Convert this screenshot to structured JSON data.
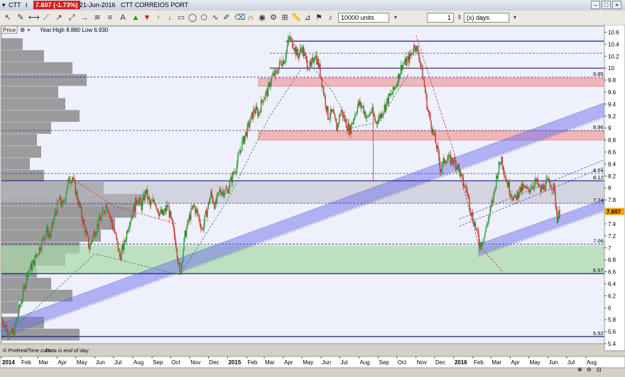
{
  "window": {
    "symbol": "CTT",
    "price_badge": "7.607 (-1.73%)",
    "date": "21-Jun-2016",
    "name": "CTT CORREIOS PORT"
  },
  "toolbar": {
    "quantity": "10000 units",
    "period_count": "1",
    "period_unit": "(x) days",
    "icons": [
      "cursor-icon",
      "pencil-icon",
      "horizontal-line-icon",
      "trend-line-icon",
      "ray-icon",
      "extend-line-icon",
      "horizontal-ray-icon",
      "parallel-channel-icon",
      "fibonacci-icon",
      "text-icon",
      "buy-arrow-icon",
      "sell-arrow-icon",
      "up-arrow-icon",
      "down-arrow-icon",
      "rectangle-icon",
      "ellipse-icon",
      "polygon-icon",
      "curve-icon",
      "brush-icon",
      "eraser-icon",
      "magnet-icon",
      "eye-icon",
      "settings-icon",
      "grid-icon",
      "ruler-icon",
      "measure-icon",
      "flag-icon",
      "bell-icon",
      "lock-icon",
      "trash-icon"
    ]
  },
  "info": {
    "price_label": "Price",
    "range_text": "Year:High 8.880 Low 6.930",
    "footer_brand": "© ProRealTime.com",
    "footer_note": "Data is end of day"
  },
  "colors": {
    "plot_bg": "#ffffff",
    "plot_bg_tint": "#eef0fb",
    "up_candle": "#2e9a3a",
    "down_candle": "#c0392b",
    "channel": "#6b6bef",
    "resistance": "#1a1a8c",
    "red_zone": "#f2a0a0",
    "green_zone": "#a8d8a8",
    "gray_zone": "#bdbdc9",
    "volume_profile": "#8c8c8c",
    "last_price": "#ffa000"
  },
  "chart_data": {
    "type": "candlestick",
    "title": "CTT CORREIOS PORT",
    "x_range": [
      "2014-01-01",
      "2016-08-31"
    ],
    "ylim": [
      5.4,
      10.7
    ],
    "y_ticks": [
      "5.4",
      "5.6",
      "5.8",
      "6",
      "6.2",
      "6.4",
      "6.6",
      "6.8",
      "7",
      "7.2",
      "7.4",
      "7.6",
      "7.8",
      "8",
      "8.2",
      "8.4",
      "8.6",
      "8.8",
      "9",
      "9.2",
      "9.4",
      "9.6",
      "9.8",
      "10",
      "10.2",
      "10.4",
      "10.6"
    ],
    "x_ticks": [
      {
        "label": "2014",
        "date": "2014-01-01"
      },
      {
        "label": "Feb",
        "date": "2014-02-01"
      },
      {
        "label": "Mar",
        "date": "2014-03-01"
      },
      {
        "label": "Apr",
        "date": "2014-04-01"
      },
      {
        "label": "May",
        "date": "2014-05-01"
      },
      {
        "label": "Jun",
        "date": "2014-06-01"
      },
      {
        "label": "Jul",
        "date": "2014-07-01"
      },
      {
        "label": "Aug",
        "date": "2014-08-01"
      },
      {
        "label": "Sep",
        "date": "2014-09-01"
      },
      {
        "label": "Oct",
        "date": "2014-10-01"
      },
      {
        "label": "Nov",
        "date": "2014-11-01"
      },
      {
        "label": "Dec",
        "date": "2014-12-01"
      },
      {
        "label": "2015",
        "date": "2015-01-01"
      },
      {
        "label": "Feb",
        "date": "2015-02-01"
      },
      {
        "label": "Mar",
        "date": "2015-03-01"
      },
      {
        "label": "Apr",
        "date": "2015-04-01"
      },
      {
        "label": "May",
        "date": "2015-05-01"
      },
      {
        "label": "Jun",
        "date": "2015-06-01"
      },
      {
        "label": "Jul",
        "date": "2015-07-01"
      },
      {
        "label": "Aug",
        "date": "2015-08-01"
      },
      {
        "label": "Sep",
        "date": "2015-09-01"
      },
      {
        "label": "Oct",
        "date": "2015-10-01"
      },
      {
        "label": "Nov",
        "date": "2015-11-01"
      },
      {
        "label": "Dec",
        "date": "2015-12-01"
      },
      {
        "label": "2016",
        "date": "2016-01-01"
      },
      {
        "label": "Feb",
        "date": "2016-02-01"
      },
      {
        "label": "Mar",
        "date": "2016-03-01"
      },
      {
        "label": "Apr",
        "date": "2016-04-01"
      },
      {
        "label": "May",
        "date": "2016-05-01"
      },
      {
        "label": "Jun",
        "date": "2016-06-01"
      },
      {
        "label": "Jul",
        "date": "2016-07-01"
      },
      {
        "label": "Aug",
        "date": "2016-08-01"
      }
    ],
    "price_path": [
      [
        "2014-01-02",
        5.8
      ],
      [
        "2014-01-10",
        5.62
      ],
      [
        "2014-01-20",
        5.55
      ],
      [
        "2014-01-28",
        5.9
      ],
      [
        "2014-02-05",
        6.25
      ],
      [
        "2014-02-12",
        6.6
      ],
      [
        "2014-02-20",
        6.7
      ],
      [
        "2014-02-27",
        6.9
      ],
      [
        "2014-03-06",
        7.05
      ],
      [
        "2014-03-14",
        7.3
      ],
      [
        "2014-03-21",
        7.2
      ],
      [
        "2014-03-28",
        7.55
      ],
      [
        "2014-04-04",
        7.8
      ],
      [
        "2014-04-11",
        7.7
      ],
      [
        "2014-04-17",
        8.05
      ],
      [
        "2014-04-25",
        8.2
      ],
      [
        "2014-05-02",
        7.9
      ],
      [
        "2014-05-09",
        7.6
      ],
      [
        "2014-05-16",
        7.3
      ],
      [
        "2014-05-23",
        7.0
      ],
      [
        "2014-05-30",
        7.25
      ],
      [
        "2014-06-06",
        7.4
      ],
      [
        "2014-06-13",
        7.55
      ],
      [
        "2014-06-20",
        7.75
      ],
      [
        "2014-06-27",
        7.45
      ],
      [
        "2014-07-04",
        7.2
      ],
      [
        "2014-07-11",
        6.85
      ],
      [
        "2014-07-18",
        7.05
      ],
      [
        "2014-07-25",
        7.4
      ],
      [
        "2014-08-01",
        7.6
      ],
      [
        "2014-08-08",
        7.85
      ],
      [
        "2014-08-15",
        7.7
      ],
      [
        "2014-08-22",
        7.95
      ],
      [
        "2014-08-29",
        7.7
      ],
      [
        "2014-09-05",
        7.8
      ],
      [
        "2014-09-12",
        7.6
      ],
      [
        "2014-09-19",
        7.55
      ],
      [
        "2014-09-26",
        7.7
      ],
      [
        "2014-10-03",
        7.4
      ],
      [
        "2014-10-10",
        7.05
      ],
      [
        "2014-10-16",
        6.55
      ],
      [
        "2014-10-24",
        7.2
      ],
      [
        "2014-10-31",
        7.5
      ],
      [
        "2014-11-07",
        7.7
      ],
      [
        "2014-11-14",
        7.55
      ],
      [
        "2014-11-21",
        7.3
      ],
      [
        "2014-11-28",
        7.6
      ],
      [
        "2014-12-05",
        7.9
      ],
      [
        "2014-12-12",
        7.7
      ],
      [
        "2014-12-19",
        7.95
      ],
      [
        "2014-12-31",
        7.95
      ],
      [
        "2015-01-09",
        8.2
      ],
      [
        "2015-01-16",
        8.4
      ],
      [
        "2015-01-23",
        8.7
      ],
      [
        "2015-01-30",
        8.9
      ],
      [
        "2015-02-06",
        9.1
      ],
      [
        "2015-02-13",
        9.3
      ],
      [
        "2015-02-20",
        9.25
      ],
      [
        "2015-02-27",
        9.5
      ],
      [
        "2015-03-06",
        9.6
      ],
      [
        "2015-03-13",
        9.85
      ],
      [
        "2015-03-20",
        9.9
      ],
      [
        "2015-03-27",
        10.1
      ],
      [
        "2015-04-03",
        10.15
      ],
      [
        "2015-04-10",
        10.5
      ],
      [
        "2015-04-17",
        10.4
      ],
      [
        "2015-04-24",
        10.2
      ],
      [
        "2015-05-01",
        10.35
      ],
      [
        "2015-05-08",
        10.1
      ],
      [
        "2015-05-15",
        10.0
      ],
      [
        "2015-05-22",
        10.25
      ],
      [
        "2015-05-29",
        10.0
      ],
      [
        "2015-06-05",
        9.6
      ],
      [
        "2015-06-12",
        9.2
      ],
      [
        "2015-06-19",
        9.25
      ],
      [
        "2015-06-26",
        9.0
      ],
      [
        "2015-07-03",
        9.3
      ],
      [
        "2015-07-10",
        9.1
      ],
      [
        "2015-07-17",
        8.95
      ],
      [
        "2015-07-24",
        9.2
      ],
      [
        "2015-07-31",
        9.4
      ],
      [
        "2015-08-07",
        9.35
      ],
      [
        "2015-08-14",
        9.15
      ],
      [
        "2015-08-21",
        9.3
      ],
      [
        "2015-08-28",
        9.1
      ],
      [
        "2015-09-04",
        9.2
      ],
      [
        "2015-09-11",
        9.35
      ],
      [
        "2015-09-18",
        9.5
      ],
      [
        "2015-09-25",
        9.6
      ],
      [
        "2015-10-02",
        9.8
      ],
      [
        "2015-10-09",
        10.05
      ],
      [
        "2015-10-16",
        10.1
      ],
      [
        "2015-10-23",
        10.2
      ],
      [
        "2015-10-30",
        10.4
      ],
      [
        "2015-11-06",
        10.2
      ],
      [
        "2015-11-13",
        9.8
      ],
      [
        "2015-11-20",
        9.3
      ],
      [
        "2015-11-27",
        9.0
      ],
      [
        "2015-12-04",
        8.7
      ],
      [
        "2015-12-11",
        8.3
      ],
      [
        "2015-12-18",
        8.5
      ],
      [
        "2015-12-31",
        8.45
      ],
      [
        "2016-01-08",
        8.35
      ],
      [
        "2016-01-15",
        8.1
      ],
      [
        "2016-01-22",
        7.95
      ],
      [
        "2016-01-29",
        7.6
      ],
      [
        "2016-02-05",
        7.35
      ],
      [
        "2016-02-12",
        7.05
      ],
      [
        "2016-02-19",
        7.2
      ],
      [
        "2016-02-26",
        7.5
      ],
      [
        "2016-03-04",
        7.8
      ],
      [
        "2016-03-11",
        8.25
      ],
      [
        "2016-03-18",
        8.5
      ],
      [
        "2016-03-25",
        8.15
      ],
      [
        "2016-04-01",
        7.95
      ],
      [
        "2016-04-08",
        7.8
      ],
      [
        "2016-04-15",
        7.95
      ],
      [
        "2016-04-22",
        8.0
      ],
      [
        "2016-04-29",
        7.95
      ],
      [
        "2016-05-06",
        8.05
      ],
      [
        "2016-05-13",
        8.1
      ],
      [
        "2016-05-20",
        7.95
      ],
      [
        "2016-05-27",
        8.05
      ],
      [
        "2016-06-03",
        8.1
      ],
      [
        "2016-06-10",
        8.0
      ],
      [
        "2016-06-16",
        7.5
      ],
      [
        "2016-06-21",
        7.607
      ]
    ],
    "last_price": 7.607,
    "horizontal_levels": [
      {
        "value": 5.52,
        "label": "5.52",
        "style": "solid"
      },
      {
        "value": 6.57,
        "label": "6.57",
        "style": "solid"
      },
      {
        "value": 7.064,
        "label": "7.064",
        "style": "dashed"
      },
      {
        "value": 7.743,
        "label": "7.743",
        "style": "dashed"
      },
      {
        "value": 8.12,
        "label": "8.12",
        "style": "solid"
      },
      {
        "value": 8.24,
        "label": "8.24",
        "style": "dashed"
      },
      {
        "value": 8.96,
        "label": "8.96",
        "style": "dashed"
      },
      {
        "value": 9.85,
        "label": "9.85",
        "style": "dashed"
      },
      {
        "value": 10.0,
        "label": "",
        "style": "solid"
      },
      {
        "value": 10.25,
        "label": "",
        "style": "dashed"
      },
      {
        "value": 10.45,
        "label": "",
        "style": "solid"
      }
    ],
    "zones": [
      {
        "kind": "green",
        "from": 6.57,
        "to": 7.04,
        "start": "2014-01-01"
      },
      {
        "kind": "gray",
        "from": 7.74,
        "to": 8.12,
        "start": "2014-01-01"
      },
      {
        "kind": "red",
        "from": 8.8,
        "to": 8.95,
        "start": "2015-02-20"
      },
      {
        "kind": "red",
        "from": 9.7,
        "to": 9.83,
        "start": "2015-02-20"
      }
    ],
    "channels": [
      {
        "start": [
          "2014-01-01",
          5.52
        ],
        "end": [
          "2016-08-31",
          9.2
        ],
        "width": 0.22
      },
      {
        "start": [
          "2016-02-10",
          6.88
        ],
        "end": [
          "2016-08-31",
          7.63
        ],
        "width": 0.18
      }
    ],
    "volume_profile": [
      {
        "price": 5.55,
        "volume": 0.55
      },
      {
        "price": 5.75,
        "volume": 0.3
      },
      {
        "price": 6.0,
        "volume": 0.12
      },
      {
        "price": 6.2,
        "volume": 0.5
      },
      {
        "price": 6.4,
        "volume": 0.35
      },
      {
        "price": 6.6,
        "volume": 0.25
      },
      {
        "price": 6.8,
        "volume": 0.45
      },
      {
        "price": 7.0,
        "volume": 0.55
      },
      {
        "price": 7.2,
        "volume": 0.7
      },
      {
        "price": 7.4,
        "volume": 0.8
      },
      {
        "price": 7.6,
        "volume": 0.95
      },
      {
        "price": 7.8,
        "volume": 1.0
      },
      {
        "price": 8.0,
        "volume": 0.72
      },
      {
        "price": 8.2,
        "volume": 0.3
      },
      {
        "price": 8.4,
        "volume": 0.2
      },
      {
        "price": 8.6,
        "volume": 0.28
      },
      {
        "price": 8.8,
        "volume": 0.25
      },
      {
        "price": 9.0,
        "volume": 0.35
      },
      {
        "price": 9.2,
        "volume": 0.55
      },
      {
        "price": 9.4,
        "volume": 0.45
      },
      {
        "price": 9.6,
        "volume": 0.4
      },
      {
        "price": 9.8,
        "volume": 0.6
      },
      {
        "price": 10.0,
        "volume": 0.5
      },
      {
        "price": 10.2,
        "volume": 0.3
      },
      {
        "price": 10.4,
        "volume": 0.15
      }
    ]
  }
}
